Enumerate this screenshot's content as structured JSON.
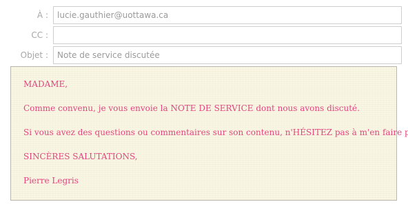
{
  "compose": {
    "to": {
      "label": "À :",
      "value": "lucie.gauthier@uottawa.ca"
    },
    "cc": {
      "label": "CC :",
      "value": ""
    },
    "subject": {
      "label": "Objet :",
      "placeholder": "Note de service discutée"
    }
  },
  "body": {
    "text_color": "#e2457e",
    "background_color": "#f9f7e3",
    "paragraphs": [
      "MADAME,",
      "Comme convenu, je vous envoie la NOTE DE SERVICE dont nous avons discuté.",
      "Si vous avez des questions ou commentaires sur son contenu, n'HÉSITEZ pas à m'en faire part.",
      "SINCÈRES SALUTATIONS,",
      "Pierre Legris"
    ]
  }
}
